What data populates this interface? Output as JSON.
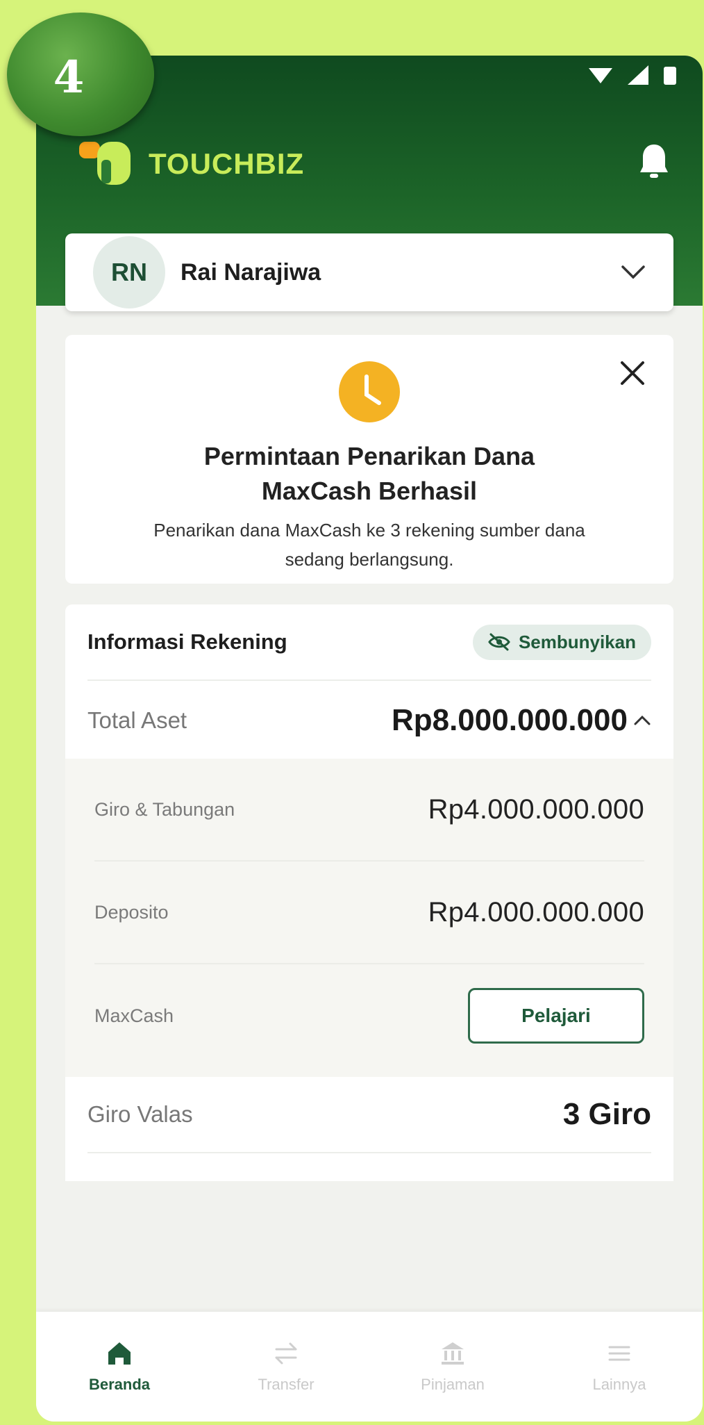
{
  "step_badge": "4",
  "app": {
    "name": "TOUCHBIZ"
  },
  "user": {
    "initials": "RN",
    "name": "Rai Narajiwa"
  },
  "notification": {
    "title_line1": "Permintaan Penarikan Dana",
    "title_line2": "MaxCash Berhasil",
    "desc_line1": "Penarikan dana MaxCash ke 3 rekening sumber dana",
    "desc_line2": "sedang berlangsung."
  },
  "account_info": {
    "title": "Informasi Rekening",
    "hide_label": "Sembunyikan",
    "total_label": "Total Aset",
    "total_value": "Rp8.000.000.000",
    "rows": [
      {
        "label": "Giro & Tabungan",
        "value": "Rp4.000.000.000"
      },
      {
        "label": "Deposito",
        "value": "Rp4.000.000.000"
      },
      {
        "label": "MaxCash",
        "button": "Pelajari"
      }
    ]
  },
  "giro_valas": {
    "label": "Giro Valas",
    "value": "3 Giro"
  },
  "nav": [
    {
      "label": "Beranda",
      "icon": "home-icon",
      "active": true
    },
    {
      "label": "Transfer",
      "icon": "transfer-icon"
    },
    {
      "label": "Pinjaman",
      "icon": "bank-icon"
    },
    {
      "label": "Lainnya",
      "icon": "menu-icon"
    }
  ],
  "colors": {
    "accent": "#1f5a3a",
    "brand_lime": "#c8ec5a",
    "warning": "#f4b223"
  }
}
